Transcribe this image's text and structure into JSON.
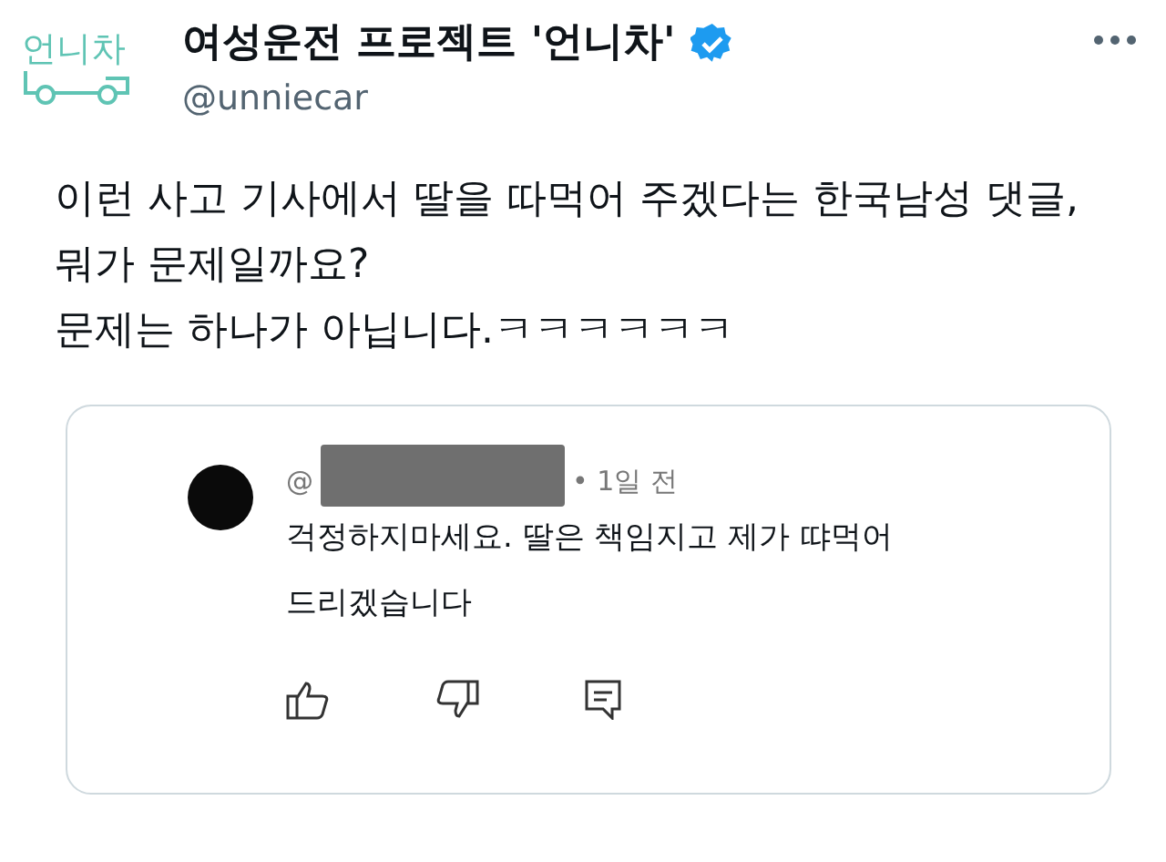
{
  "account": {
    "logo_text": "언니차",
    "name": "여성운전 프로젝트 '언니차'",
    "verified": true,
    "handle": "@unniecar"
  },
  "tweet": {
    "paragraphs": [
      "이런 사고 기사에서 딸을 따먹어 주겠다는 한국남성 댓글, 뭐가 문제일까요?",
      "문제는 하나가 아닙니다.ㅋㅋㅋㅋㅋㅋ"
    ]
  },
  "quoted_comment": {
    "author": "@",
    "author_redacted": true,
    "time": "• 1일 전",
    "text": "걱정하지마세요. 딸은 책임지고 제가 땨먹어드리겠습니다"
  }
}
